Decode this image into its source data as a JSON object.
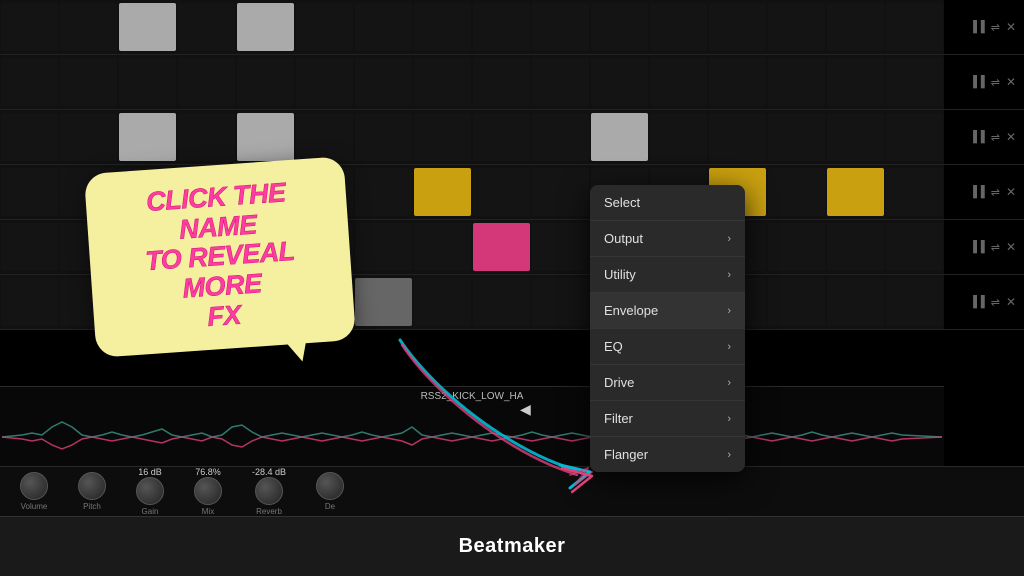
{
  "app": {
    "title": "Beatmaker"
  },
  "tooltip": {
    "text": "CLICK THE NAME\nTO REVEAL MORE\nFX"
  },
  "context_menu": {
    "items": [
      {
        "label": "Select",
        "has_submenu": false
      },
      {
        "label": "Output",
        "has_submenu": true
      },
      {
        "label": "Utility",
        "has_submenu": true
      },
      {
        "label": "Envelope",
        "has_submenu": true
      },
      {
        "label": "EQ",
        "has_submenu": true
      },
      {
        "label": "Drive",
        "has_submenu": true
      },
      {
        "label": "Filter",
        "has_submenu": true
      },
      {
        "label": "Flanger",
        "has_submenu": true
      }
    ]
  },
  "track_controls": {
    "icons": [
      "📊",
      "⚡",
      "✕"
    ]
  },
  "knobs": [
    {
      "label": "Volume",
      "value": ""
    },
    {
      "label": "Pitch",
      "value": ""
    },
    {
      "label": "Gain",
      "value": "16 dB"
    },
    {
      "label": "Mix",
      "value": "76.8%"
    },
    {
      "label": "Reverb",
      "value": "-28.4 dB"
    },
    {
      "label": "De",
      "value": ""
    }
  ],
  "waveform": {
    "label": "RSS2_KICK_LOW_HA"
  },
  "colors": {
    "background": "#000000",
    "menu_bg": "#2a2a2a",
    "tooltip_bg": "#f5f0a0",
    "tooltip_text": "#ff3da0",
    "active_cell": "#aaaaaa",
    "yellow_cell": "#c9a010",
    "pink_cell": "#d43878",
    "footer_bg": "#1a1a1a",
    "accent": "#ff3da0"
  }
}
